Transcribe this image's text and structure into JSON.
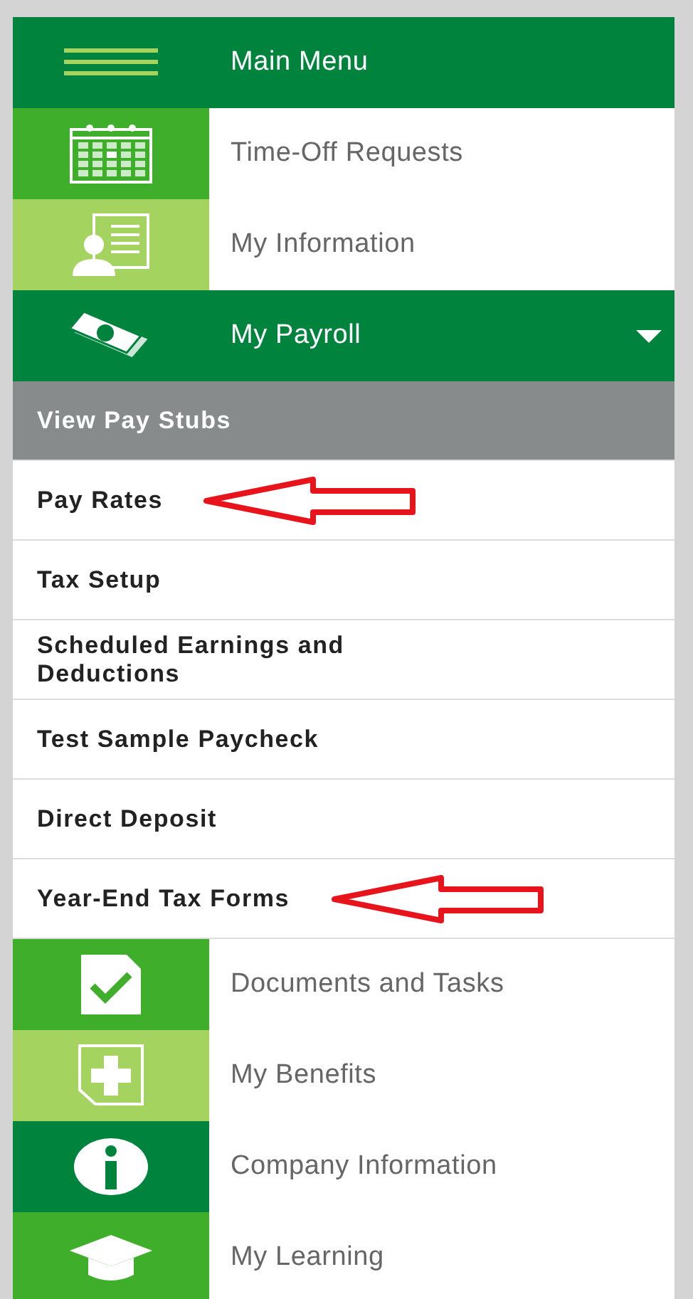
{
  "menu": [
    {
      "label": "Main Menu",
      "kind": "header",
      "color": "#00843d"
    },
    {
      "label": "Time-Off Requests",
      "kind": "link",
      "color": "#3fae2a"
    },
    {
      "label": "My Information",
      "kind": "link",
      "color": "#a5d35f"
    },
    {
      "label": "My Payroll",
      "kind": "header",
      "color": "#00843d",
      "expanded": true,
      "children": [
        {
          "label": "View Pay Stubs",
          "selected": true,
          "arrow": false
        },
        {
          "label": "Pay Rates",
          "selected": false,
          "arrow": true
        },
        {
          "label": "Tax Setup",
          "selected": false,
          "arrow": false
        },
        {
          "label": "Scheduled Earnings and Deductions",
          "selected": false,
          "arrow": false
        },
        {
          "label": "Test Sample Paycheck",
          "selected": false,
          "arrow": false
        },
        {
          "label": "Direct Deposit",
          "selected": false,
          "arrow": false
        },
        {
          "label": "Year-End Tax Forms",
          "selected": false,
          "arrow": true
        }
      ]
    },
    {
      "label": "Documents and Tasks",
      "kind": "link",
      "color": "#3fae2a"
    },
    {
      "label": "My Benefits",
      "kind": "link",
      "color": "#a5d35f"
    },
    {
      "label": "Company Information",
      "kind": "link",
      "color": "#00843d"
    },
    {
      "label": "My Learning",
      "kind": "link",
      "color": "#3fae2a"
    }
  ]
}
